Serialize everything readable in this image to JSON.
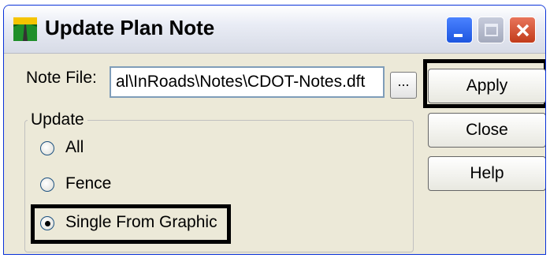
{
  "window": {
    "title": "Update Plan Note",
    "app_icon": "inroads-landscape-icon",
    "controls": {
      "minimize": "minimize-icon",
      "maximize": "maximize-icon",
      "close": "close-icon"
    }
  },
  "note_file": {
    "label": "Note File:",
    "value": "al\\InRoads\\Notes\\CDOT-Notes.dft",
    "browse_label": "..."
  },
  "buttons": {
    "apply": "Apply",
    "close": "Close",
    "help": "Help"
  },
  "update_group": {
    "label": "Update",
    "options": [
      {
        "label": "All",
        "checked": false
      },
      {
        "label": "Fence",
        "checked": false
      },
      {
        "label": "Single From Graphic",
        "checked": true
      }
    ]
  },
  "colors": {
    "titlebar_border": "#0831d9",
    "dialog_bg": "#ece9d8",
    "close_button": "#c23c1b",
    "minimize_button": "#1d56e0"
  }
}
